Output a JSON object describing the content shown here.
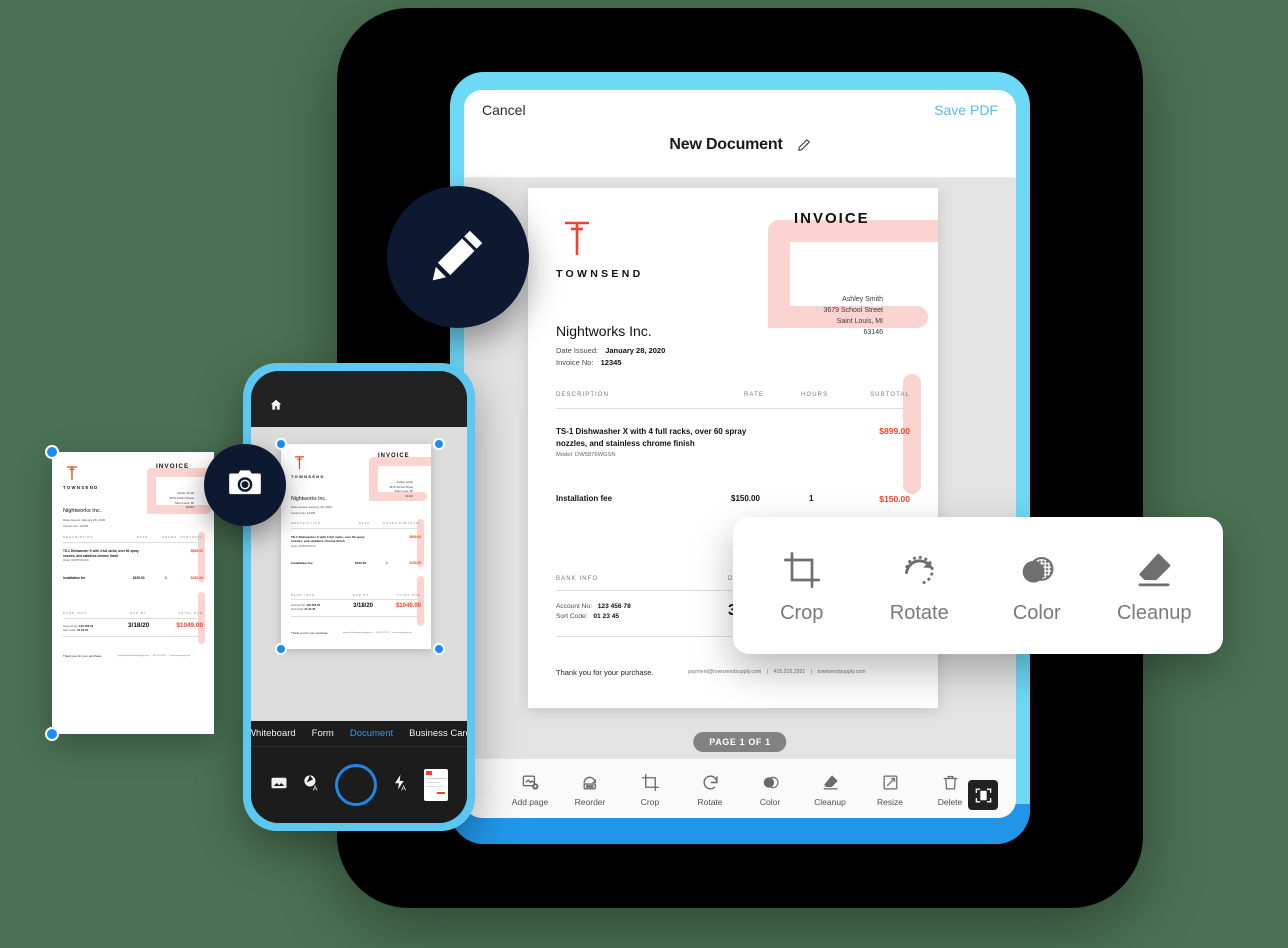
{
  "background_color": "#4a7153",
  "tablet": {
    "header": {
      "cancel_label": "Cancel",
      "save_label": "Save PDF",
      "title": "New Document",
      "edit_icon": "pencil-icon"
    },
    "page_indicator": "PAGE 1 OF 1",
    "toolbar": [
      {
        "label": "Add page",
        "icon": "add-page-icon"
      },
      {
        "label": "Reorder",
        "icon": "reorder-icon"
      },
      {
        "label": "Crop",
        "icon": "crop-icon"
      },
      {
        "label": "Rotate",
        "icon": "rotate-icon"
      },
      {
        "label": "Color",
        "icon": "color-icon"
      },
      {
        "label": "Cleanup",
        "icon": "cleanup-icon"
      },
      {
        "label": "Resize",
        "icon": "resize-icon"
      },
      {
        "label": "Delete",
        "icon": "trash-icon"
      }
    ],
    "scan_badge_icon": "scan-document-icon"
  },
  "tool_panel": {
    "items": [
      {
        "label": "Crop",
        "icon": "crop-icon"
      },
      {
        "label": "Rotate",
        "icon": "rotate-icon"
      },
      {
        "label": "Color",
        "icon": "color-icon"
      },
      {
        "label": "Cleanup",
        "icon": "eraser-icon"
      }
    ]
  },
  "phone": {
    "home_icon": "home-icon",
    "tabs": [
      {
        "label": "Whiteboard",
        "active": false
      },
      {
        "label": "Form",
        "active": false
      },
      {
        "label": "Document",
        "active": true
      },
      {
        "label": "Business Card",
        "active": false
      }
    ],
    "controls": {
      "gallery_icon": "gallery-icon",
      "filter_icon": "auto-filter-icon",
      "shutter_icon": "shutter-button",
      "flash_icon": "flash-auto-icon",
      "thumbnail_icon": "last-capture-thumbnail"
    }
  },
  "badges": {
    "pencil": {
      "icon": "pencil-icon",
      "color": "#0d1831"
    },
    "camera": {
      "icon": "camera-icon",
      "color": "#0d1831"
    }
  },
  "invoice": {
    "brand": "TOWNSEND",
    "logo_icon": "townsend-t-logo",
    "heading": "INVOICE",
    "client": "Nightworks Inc.",
    "date_label": "Date Issued:",
    "date_value": "January 28, 2020",
    "invoice_label": "Invoice No:",
    "invoice_value": "12345",
    "recipient": {
      "name": "Ashley Smith",
      "street": "3679  School Street",
      "city": "Saint Louis, MI",
      "zip": "63146"
    },
    "columns": {
      "description": "DESCRIPTION",
      "rate": "RATE",
      "hours": "HOURS",
      "subtotal": "SUBTOTAL"
    },
    "items": [
      {
        "description": "TS-1 Dishwasher X with 4 full racks, over 60 spray nozzles, and stainless chrome finish",
        "model": "Model: DW5876WGSN",
        "rate": "",
        "hours": "",
        "subtotal": "$899.00"
      },
      {
        "description": "Installation fee",
        "model": "",
        "rate": "$150.00",
        "hours": "1",
        "subtotal": "$150.00"
      }
    ],
    "bank_label": "BANK INFO",
    "due_label": "DUE BY",
    "total_label": "TOTAL DUE",
    "account_label": "Account No:",
    "account_value": "123 456 78",
    "sort_label": "Sort Code:",
    "sort_value": "01 23 45",
    "due_date": "3/18/20",
    "total_due": "$1049.00",
    "thanks": "Thank you for your purchase.",
    "contact_email": "payment@townsendsupply.com",
    "contact_phone": "415.215.2921",
    "contact_site": "townsendsupply.com",
    "accent_color": "#f5402c",
    "pink_color": "#fbd3d0"
  }
}
